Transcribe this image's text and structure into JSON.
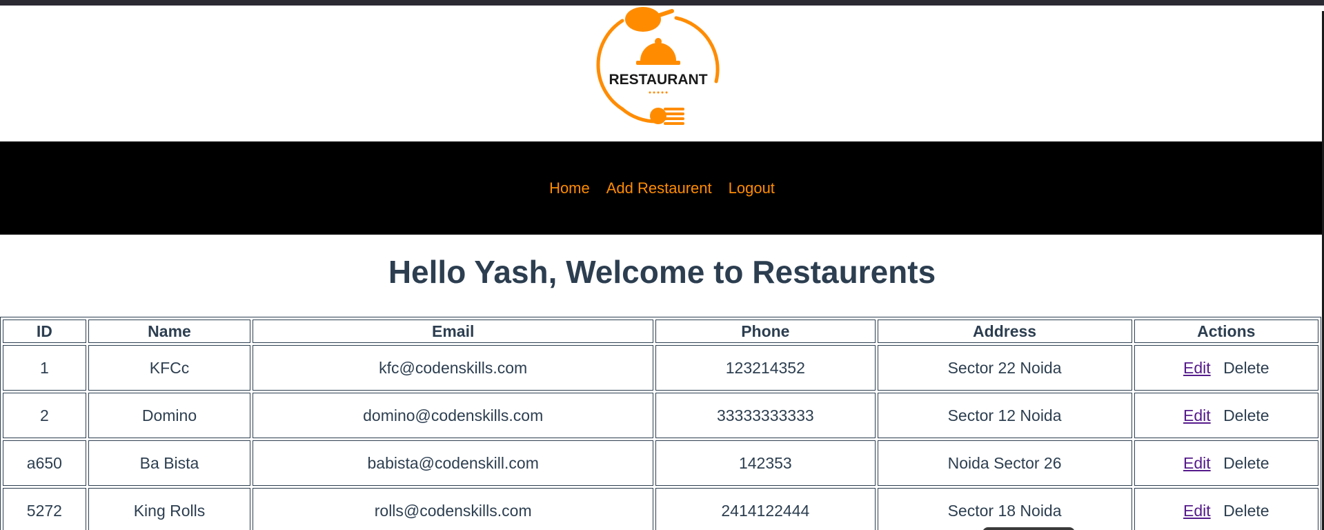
{
  "logo": {
    "text": "RESTAURANT",
    "colors": {
      "orange": "#ff8c00",
      "dark": "#1a1a1a"
    }
  },
  "nav": {
    "items": [
      {
        "label": "Home"
      },
      {
        "label": "Add Restaurent"
      },
      {
        "label": "Logout"
      }
    ],
    "link_color": "#ff8c00",
    "background": "#000000"
  },
  "welcome": "Hello Yash, Welcome to Restaurents",
  "table": {
    "headers": [
      "ID",
      "Name",
      "Email",
      "Phone",
      "Address",
      "Actions"
    ],
    "rows": [
      {
        "id": "1",
        "name": "KFCc",
        "email": "kfc@codenskills.com",
        "phone": "123214352",
        "address": "Sector 22 Noida",
        "edit": "Edit",
        "delete": "Delete"
      },
      {
        "id": "2",
        "name": "Domino",
        "email": "domino@codenskills.com",
        "phone": "33333333333",
        "address": "Sector 12 Noida",
        "edit": "Edit",
        "delete": "Delete"
      },
      {
        "id": "a650",
        "name": "Ba Bista",
        "email": "babista@codenskill.com",
        "phone": "142353",
        "address": "Noida Sector 26",
        "edit": "Edit",
        "delete": "Delete"
      },
      {
        "id": "5272",
        "name": "King Rolls",
        "email": "rolls@codenskills.com",
        "phone": "2414122444",
        "address": "Sector 18 Noida",
        "edit": "Edit",
        "delete": "Delete"
      }
    ]
  }
}
